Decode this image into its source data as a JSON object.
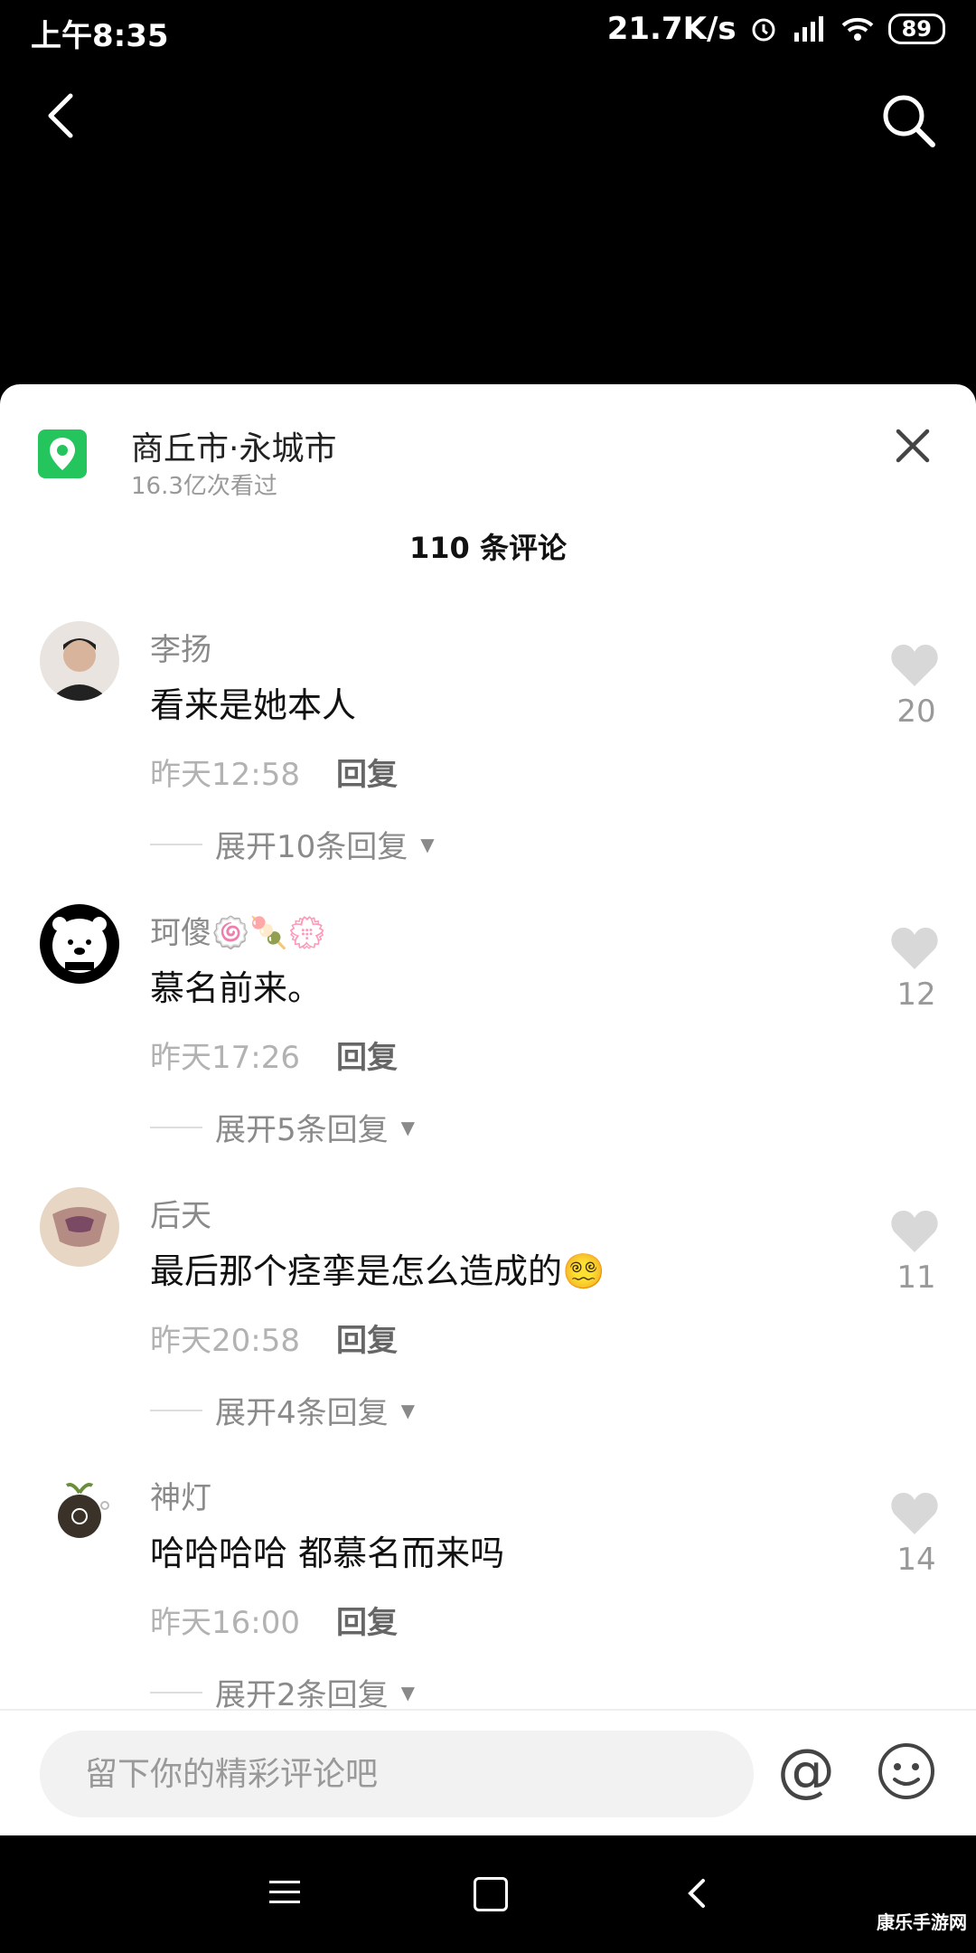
{
  "status": {
    "time": "上午8:35",
    "speed": "21.7K/s",
    "battery": "89"
  },
  "location": {
    "name": "商丘市·永城市",
    "views": "16.3亿次看过"
  },
  "comments_header": "110 条评论",
  "comments": [
    {
      "name": "李扬",
      "text": "看来是她本人",
      "time": "昨天12:58",
      "reply": "回复",
      "expand": "展开10条回复",
      "likes": "20"
    },
    {
      "name": "珂傻🍥🍡💮",
      "text": "慕名前来。",
      "time": "昨天17:26",
      "reply": "回复",
      "expand": "展开5条回复",
      "likes": "12"
    },
    {
      "name": "后天",
      "text": "最后那个痉挛是怎么造成的😵‍💫",
      "time": "昨天20:58",
      "reply": "回复",
      "expand": "展开4条回复",
      "likes": "11"
    },
    {
      "name": "神灯",
      "text": "哈哈哈哈 都慕名而来吗",
      "time": "昨天16:00",
      "reply": "回复",
      "expand": "展开2条回复",
      "likes": "14"
    }
  ],
  "input": {
    "placeholder": "留下你的精彩评论吧",
    "at_label": "@"
  },
  "watermark": "康乐手游网",
  "colors": {
    "location_icon": "#25c55d",
    "sheet_bg": "#ffffff",
    "like_icon": "#d8d8d8"
  }
}
